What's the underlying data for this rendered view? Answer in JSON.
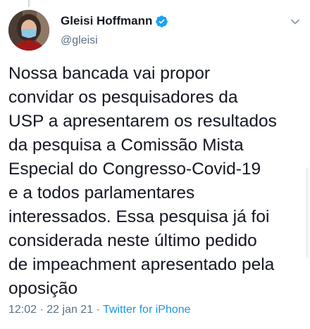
{
  "tweet": {
    "author": {
      "display_name": "Gleisi Hoffmann",
      "handle": "@gleisi",
      "verified_icon": "verified-badge-icon"
    },
    "text": "Nossa bancada vai propor\nconvidar os pesquisadores da\nUSP a apresentarem os resultados\nda pesquisa a Comissão Mista\nEspecial do Congresso-Covid-19\ne a todos parlamentares\ninteressados. Essa pesquisa já foi\nconsiderada neste último pedido\nde impeachment apresentado pela\noposição",
    "time": "12:02",
    "separator": " · ",
    "date": "22 jan 21",
    "source": "Twitter for iPhone"
  },
  "colors": {
    "text": "#141823",
    "secondary": "#5b7083",
    "accent": "#1b95e0",
    "verified": "#1da1f2"
  },
  "icons": {
    "menu": "chevron-down-icon"
  }
}
